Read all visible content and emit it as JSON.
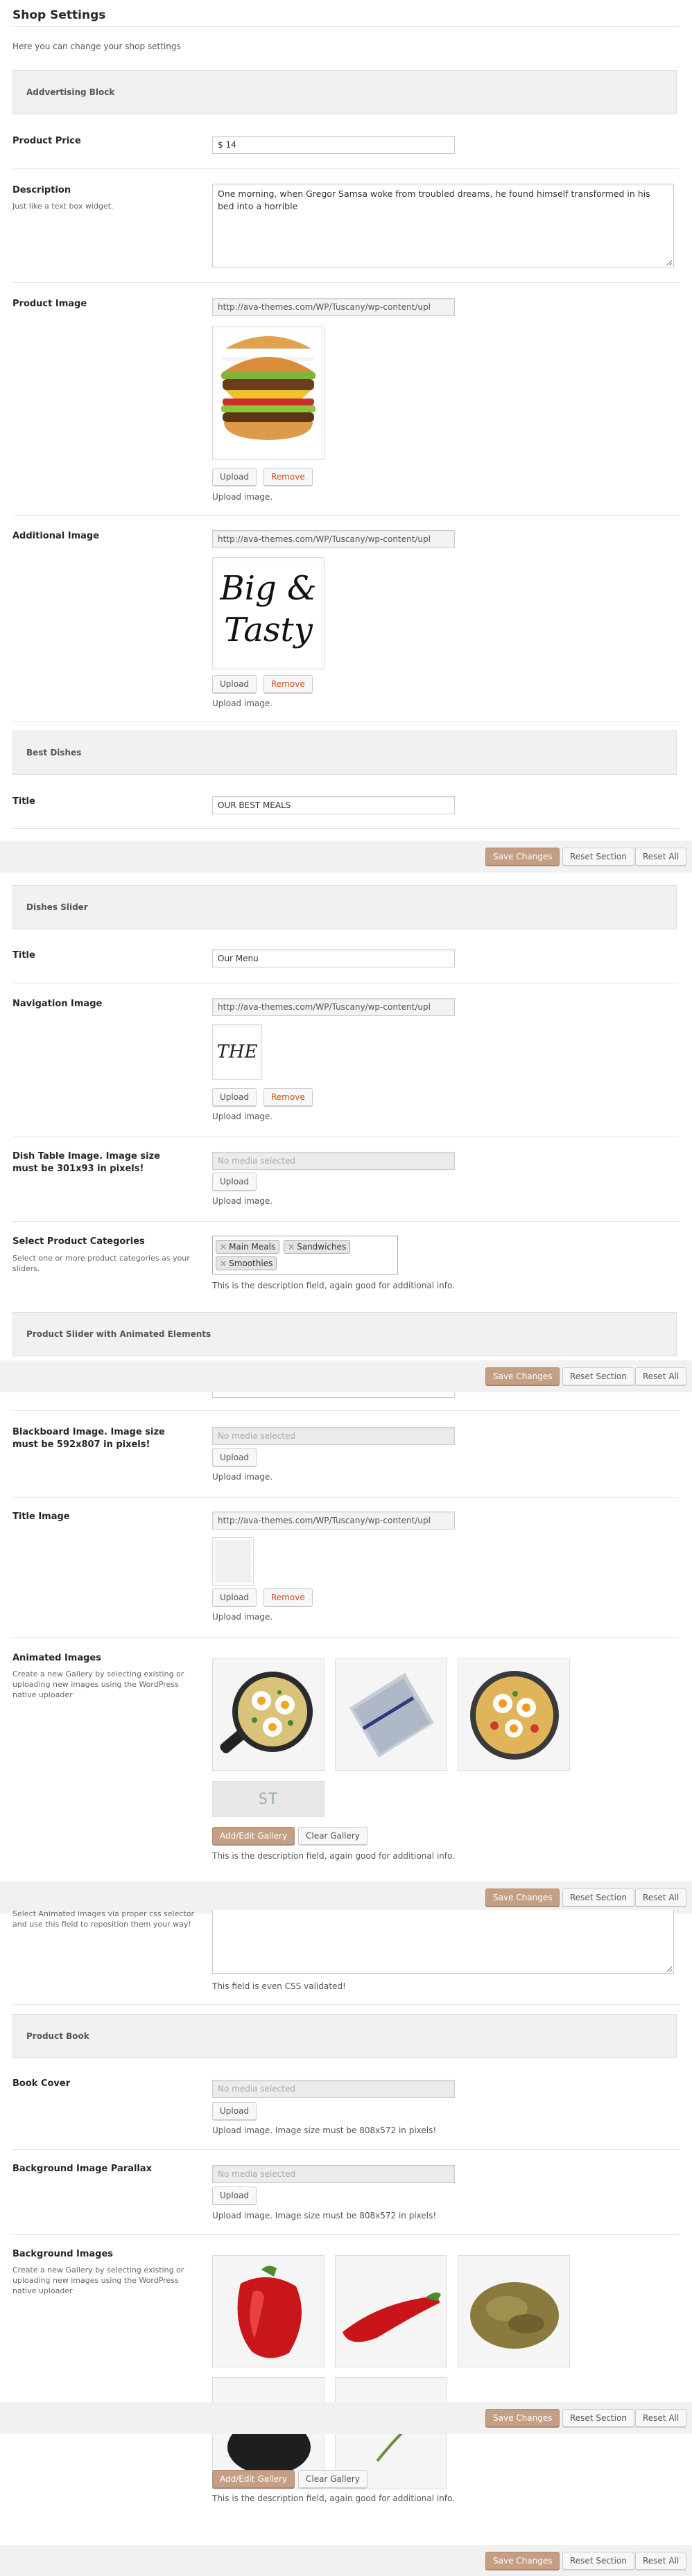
{
  "page": {
    "title": "Shop Settings",
    "description": "Here you can change your shop settings"
  },
  "sections": {
    "advertising": "Addvertising Block",
    "best_dishes": "Best Dishes",
    "dishes_slider": "Dishes Slider",
    "product_slider": "Product Slider with Animated Elements",
    "product_book": "Product Book"
  },
  "fields": {
    "product_price": {
      "label": "Product Price",
      "value": "$ 14"
    },
    "description": {
      "label": "Description",
      "sub": "Just like a text box widget.",
      "value": "One morning, when Gregor Samsa woke from troubled dreams, he found himself transformed in his bed into a horrible"
    },
    "product_image": {
      "label": "Product Image",
      "url": "http://ava-themes.com/WP/Tuscany/wp-content/upl",
      "hint": "Upload image."
    },
    "additional_image": {
      "label": "Additional Image",
      "url": "http://ava-themes.com/WP/Tuscany/wp-content/upl",
      "hint": "Upload image.",
      "art_line1": "Big &",
      "art_line2": "Tasty"
    },
    "best_title": {
      "label": "Title",
      "value": "OUR BEST MEALS"
    },
    "slider_title": {
      "label": "Title",
      "value": "Our Menu"
    },
    "navigation_image": {
      "label": "Navigation Image",
      "url": "http://ava-themes.com/WP/Tuscany/wp-content/upl",
      "hint": "Upload image.",
      "art": "THE"
    },
    "dish_table": {
      "label": "Dish Table Image. Image size must be 301x93 in pixels!",
      "placeholder": "No media selected",
      "hint": "Upload image."
    },
    "product_categories": {
      "label": "Select Product Categories",
      "sub": "Select one or more product categories as your sliders.",
      "chips": [
        "Main Meals",
        "Sandwiches",
        "Smoothies"
      ],
      "hint": "This is the description field, again good for additional info."
    },
    "blackboard": {
      "label": "Blackboard Image. Image size must be 592x807 in pixels!",
      "placeholder": "No media selected",
      "hint": "Upload image."
    },
    "title_image": {
      "label": "Title Image",
      "url": "http://ava-themes.com/WP/Tuscany/wp-content/upl",
      "hint": "Upload image."
    },
    "animated_images": {
      "label": "Animated Images",
      "sub": "Create a new Gallery by selecting existing or uploading new images using the WordPress native uploader",
      "hint": "This is the description field, again good for additional info.",
      "art": "ST INGREDIEN"
    },
    "css_position": {
      "sub": "Select Animated images via proper css selector and use this field to reposition them your way!",
      "hint": "This field is even CSS validated!"
    },
    "book_cover": {
      "label": "Book Cover",
      "placeholder": "No media selected",
      "hint": "Upload image. Image size must be 808x572 in pixels!"
    },
    "bg_parallax": {
      "label": "Background Image Parallax",
      "placeholder": "No media selected",
      "hint": "Upload image. Image size must be 808x572 in pixels!"
    },
    "bg_images": {
      "label": "Background Images",
      "sub": "Create a new Gallery by selecting existing or uploading new images using the WordPress native uploader",
      "hint": "This is the description field, again good for additional info."
    }
  },
  "buttons": {
    "upload": "Upload",
    "remove": "Remove",
    "add_edit_gallery": "Add/Edit Gallery",
    "clear_gallery": "Clear Gallery",
    "save_changes": "Save Changes",
    "reset_section": "Reset Section",
    "reset_all": "Reset All"
  },
  "colors": {
    "primary_button": "#c49f83",
    "remove_text": "#d54e21",
    "section_bg": "#f1f1f1"
  }
}
